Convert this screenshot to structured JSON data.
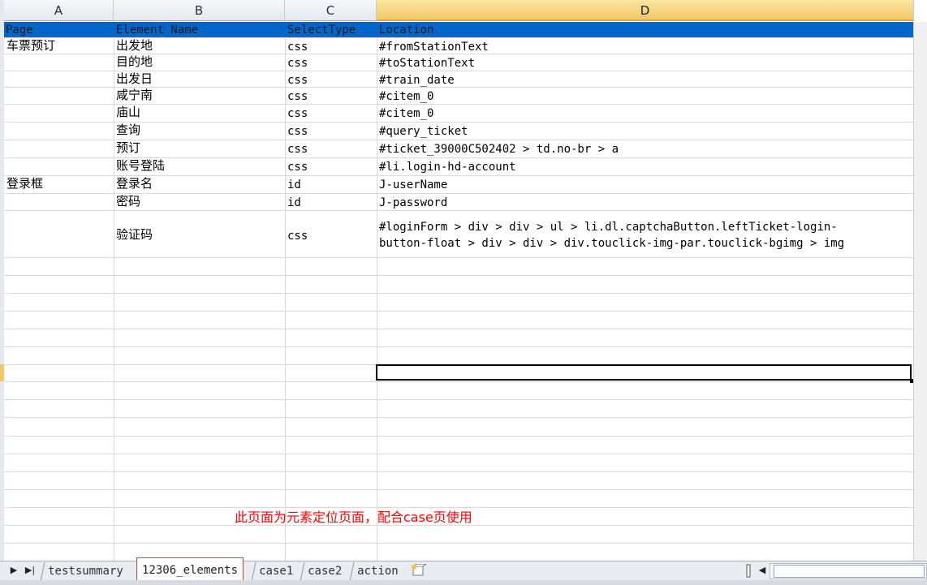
{
  "columns": [
    "A",
    "B",
    "C",
    "D"
  ],
  "selected_column": "D",
  "header_row": {
    "page": "Page",
    "element_name": "Element Name",
    "select_type": "SelectType",
    "location": "Location"
  },
  "rows": [
    {
      "page": "车票预订",
      "name": "出发地",
      "type": "css",
      "location": "#fromStationText"
    },
    {
      "page": "",
      "name": "目的地",
      "type": "css",
      "location": "#toStationText"
    },
    {
      "page": "",
      "name": "出发日",
      "type": "css",
      "location": "#train_date"
    },
    {
      "page": "",
      "name": "咸宁南",
      "type": "css",
      "location": "#citem_0"
    },
    {
      "page": "",
      "name": "庙山",
      "type": "css",
      "location": "#citem_0"
    },
    {
      "page": "",
      "name": "查询",
      "type": "css",
      "location": "#query_ticket"
    },
    {
      "page": "",
      "name": "预订",
      "type": "css",
      "location": "#ticket_39000C502402 > td.no-br > a"
    },
    {
      "page": "",
      "name": "账号登陆",
      "type": "css",
      "location": "#li.login-hd-account"
    },
    {
      "page": "登录框",
      "name": "登录名",
      "type": "id",
      "location": "J-userName"
    },
    {
      "page": "",
      "name": "密码",
      "type": "id",
      "location": "J-password"
    },
    {
      "page": "",
      "name": "验证码",
      "type": "css",
      "location_line1": "#loginForm > div > div > ul > li.dl.captchaButton.leftTicket-login-",
      "location_line2": "button-float > div > div > div.touclick-img-par.touclick-bgimg > img"
    }
  ],
  "note": "此页面为元素定位页面，配合case页使用",
  "tabs": [
    {
      "label": "testsummary",
      "active": false
    },
    {
      "label": "12306_elements",
      "active": true
    },
    {
      "label": "case1",
      "active": false
    },
    {
      "label": "case2",
      "active": false
    },
    {
      "label": "action",
      "active": false
    }
  ],
  "icons": {
    "new_sheet": "insert-sheet-icon",
    "nav_next": "next-sheet-icon",
    "nav_last": "last-sheet-icon"
  },
  "colors": {
    "header_band": "#0066cc",
    "note_text": "#ff0000",
    "active_tab_border": "#e23b3b",
    "selected_column": "#f2c768"
  }
}
